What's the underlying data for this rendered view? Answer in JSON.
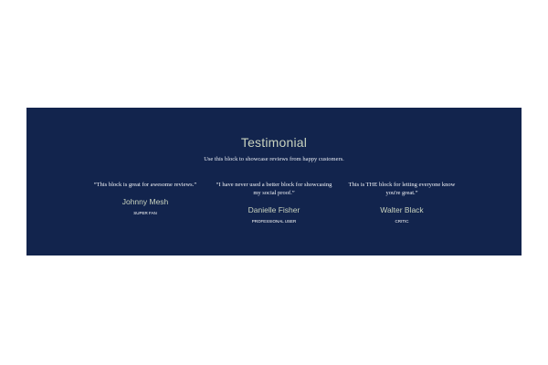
{
  "section": {
    "title": "Testimonial",
    "subtitle": "Use this block to showcase reviews from happy customers."
  },
  "reviews": [
    {
      "quote": "“This block is great for awesome reviews.”",
      "name": "Johnny Mesh",
      "role": "SUPER FAN"
    },
    {
      "quote": "“I have never used a better block for showcasing my social proof.”",
      "name": "Danielle Fisher",
      "role": "PROFESSIONAL USER"
    },
    {
      "quote": "This is THE block for letting everyone know you're great.”",
      "name": "Walter Black",
      "role": "CRITIC"
    }
  ],
  "colors": {
    "panel_background": "#12244d",
    "accent_text": "#c9d3bf",
    "page_background": "#ffffff"
  }
}
